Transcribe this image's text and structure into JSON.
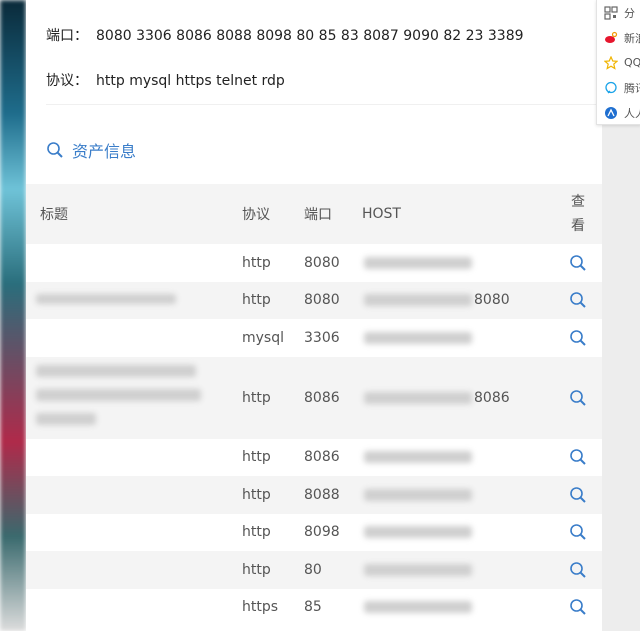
{
  "info": {
    "port_label": "端口：",
    "port_value": "8080 3306 8086 8088 8098 80 85 83 8087 9090 82 23 3389",
    "protocol_label": "协议：",
    "protocol_value": "http mysql https telnet rdp"
  },
  "section": {
    "title": "资产信息",
    "icon": "search-icon"
  },
  "table": {
    "headers": {
      "title": "标题",
      "protocol": "协议",
      "port": "端口",
      "host": "HOST",
      "view": "查看"
    },
    "rows": [
      {
        "protocol": "http",
        "port": "8080",
        "host_suffix": ""
      },
      {
        "protocol": "http",
        "port": "8080",
        "host_suffix": "8080"
      },
      {
        "protocol": "mysql",
        "port": "3306",
        "host_suffix": ""
      },
      {
        "protocol": "http",
        "port": "8086",
        "host_suffix": "8086"
      },
      {
        "protocol": "http",
        "port": "8086",
        "host_suffix": ""
      },
      {
        "protocol": "http",
        "port": "8088",
        "host_suffix": ""
      },
      {
        "protocol": "http",
        "port": "8098",
        "host_suffix": ""
      },
      {
        "protocol": "http",
        "port": "80",
        "host_suffix": ""
      },
      {
        "protocol": "https",
        "port": "85",
        "host_suffix": ""
      }
    ]
  },
  "side_menu": [
    {
      "label": "分",
      "icon": "qr-code-icon"
    },
    {
      "label": "新浪",
      "icon": "weibo-icon"
    },
    {
      "label": "QQ",
      "icon": "star-icon"
    },
    {
      "label": "腾讯",
      "icon": "chat-icon"
    },
    {
      "label": "人人",
      "icon": "renren-icon"
    }
  ],
  "colors": {
    "accent": "#3a7dc9",
    "row_alt": "#f4f4f4"
  }
}
